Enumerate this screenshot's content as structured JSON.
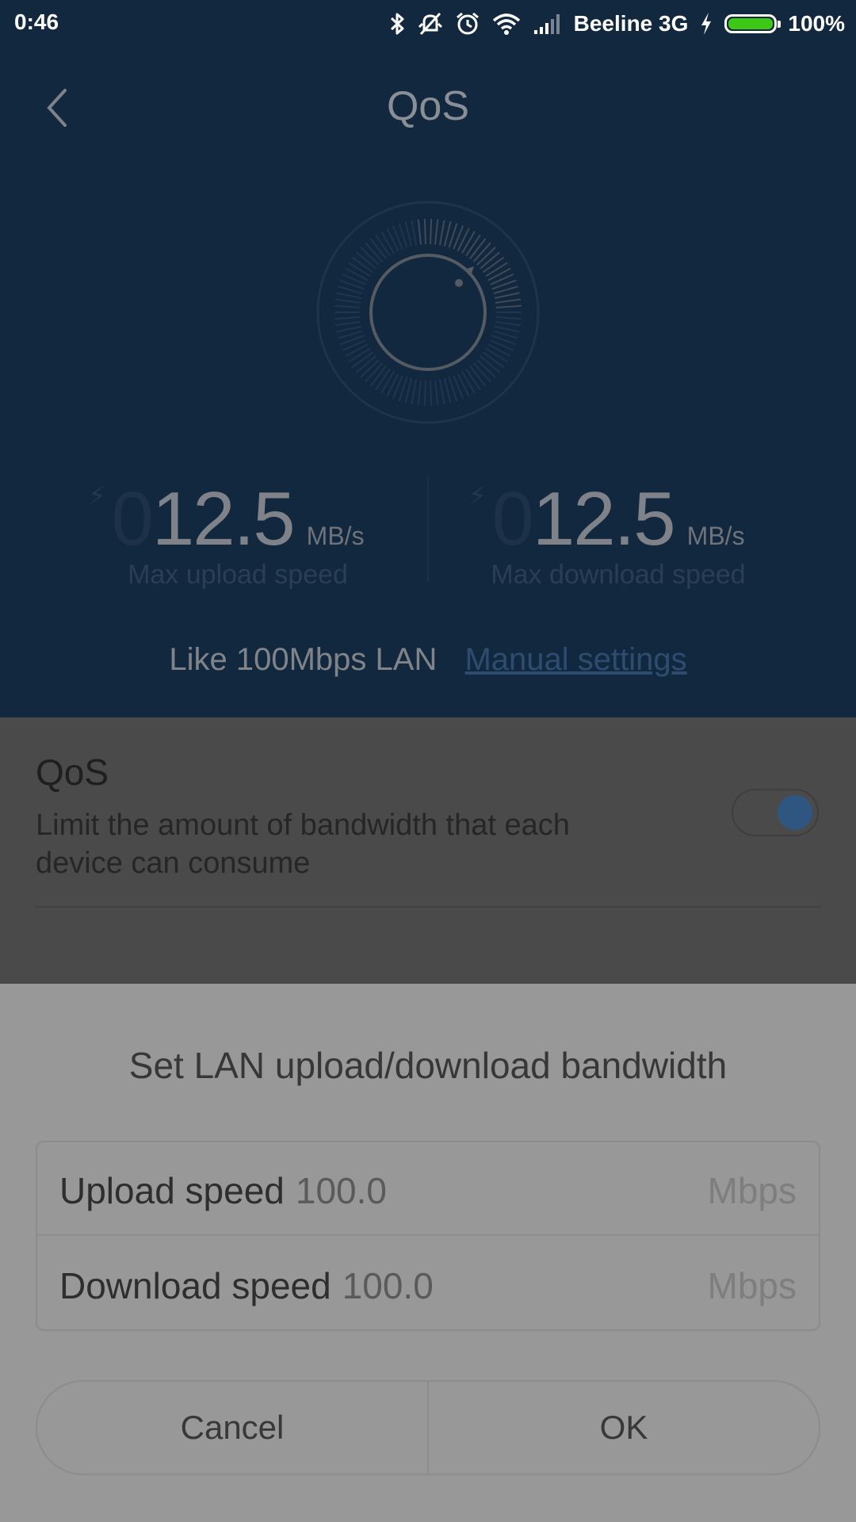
{
  "status_bar": {
    "time": "0:46",
    "carrier": "Beeline 3G",
    "battery": "100%",
    "battery_level": 1.0,
    "icons": [
      "bluetooth-icon",
      "vibrate-off-icon",
      "alarm-icon",
      "wifi-icon",
      "signal-icon",
      "charging-icon",
      "battery-icon"
    ]
  },
  "header": {
    "title": "QoS",
    "back_icon": "chevron-left-icon"
  },
  "speeds": {
    "upload": {
      "leading": "0",
      "digits": "12.5",
      "unit": "MB/s",
      "caption": "Max upload speed"
    },
    "download": {
      "leading": "0",
      "digits": "12.5",
      "unit": "MB/s",
      "caption": "Max download speed"
    }
  },
  "lan": {
    "text": "Like 100Mbps LAN",
    "manual_link": "Manual settings"
  },
  "qos_setting": {
    "title": "QoS",
    "description": "Limit the amount of bandwidth that each device can consume",
    "enabled": true
  },
  "dialog": {
    "title": "Set LAN upload/download bandwidth",
    "upload": {
      "label": "Upload speed",
      "value": "100.0",
      "unit": "Mbps"
    },
    "download": {
      "label": "Download speed",
      "value": "100.0",
      "unit": "Mbps"
    },
    "cancel_label": "Cancel",
    "ok_label": "OK"
  },
  "colors": {
    "header_bg": "#12283f",
    "section_bg": "#4a4a4a",
    "dialog_bg": "#989898",
    "toggle_knob": "#2f5680",
    "battery_fill": "#3cc814"
  }
}
